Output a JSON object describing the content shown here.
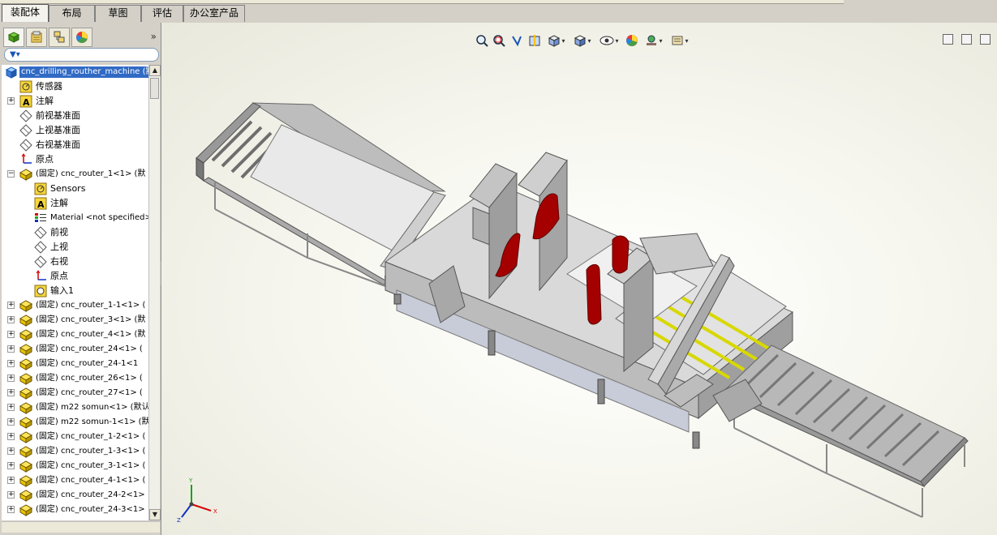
{
  "command_manager": {
    "tabs": [
      {
        "label": "装配体",
        "active": true
      },
      {
        "label": "布局",
        "active": false
      },
      {
        "label": "草图",
        "active": false
      },
      {
        "label": "评估",
        "active": false
      },
      {
        "label": "办公室产品",
        "active": false
      }
    ]
  },
  "feature_manager": {
    "panel_tabs": [
      "feature-tree",
      "property-manager",
      "configuration-manager",
      "display-manager"
    ],
    "tree": [
      {
        "label": "cnc_drilling_routher_machine (默",
        "icon": "assembly-icon",
        "expandable": false,
        "selected": true
      },
      {
        "label": "传感器",
        "icon": "sensor-icon",
        "expandable": false
      },
      {
        "label": "注解",
        "icon": "annotation-icon",
        "expandable": true,
        "symbol": "+"
      },
      {
        "label": "前视基准面",
        "icon": "plane-icon",
        "expandable": false
      },
      {
        "label": "上视基准面",
        "icon": "plane-icon",
        "expandable": false
      },
      {
        "label": "右视基准面",
        "icon": "plane-icon",
        "expandable": false
      },
      {
        "label": "原点",
        "icon": "origin-icon",
        "expandable": false
      },
      {
        "label": "(固定) cnc_router_1<1> (默",
        "icon": "part-icon",
        "expandable": true,
        "symbol": "−"
      },
      {
        "label": "Sensors",
        "icon": "sensor-icon",
        "expandable": false,
        "indent": 1
      },
      {
        "label": "注解",
        "icon": "annotation-icon",
        "expandable": false,
        "indent": 1
      },
      {
        "label": "Material <not specified>",
        "icon": "material-icon",
        "expandable": false,
        "indent": 1
      },
      {
        "label": "前视",
        "icon": "plane-icon",
        "expandable": false,
        "indent": 1
      },
      {
        "label": "上视",
        "icon": "plane-icon",
        "expandable": false,
        "indent": 1
      },
      {
        "label": "右视",
        "icon": "plane-icon",
        "expandable": false,
        "indent": 1
      },
      {
        "label": "原点",
        "icon": "origin-icon",
        "expandable": false,
        "indent": 1
      },
      {
        "label": "输入1",
        "icon": "import-icon",
        "expandable": false,
        "indent": 1
      },
      {
        "label": "(固定) cnc_router_1-1<1> (",
        "icon": "part-icon",
        "expandable": true,
        "symbol": "+"
      },
      {
        "label": "(固定) cnc_router_3<1> (默",
        "icon": "part-icon",
        "expandable": true,
        "symbol": "+"
      },
      {
        "label": "(固定) cnc_router_4<1> (默",
        "icon": "part-icon",
        "expandable": true,
        "symbol": "+"
      },
      {
        "label": "(固定) cnc_router_24<1> (",
        "icon": "part-icon",
        "expandable": true,
        "symbol": "+"
      },
      {
        "label": "(固定) cnc_router_24-1<1",
        "icon": "part-icon",
        "expandable": true,
        "symbol": "+"
      },
      {
        "label": "(固定) cnc_router_26<1> (",
        "icon": "part-icon",
        "expandable": true,
        "symbol": "+"
      },
      {
        "label": "(固定) cnc_router_27<1> (",
        "icon": "part-icon",
        "expandable": true,
        "symbol": "+"
      },
      {
        "label": "(固定) m22 somun<1> (默认",
        "icon": "part-icon",
        "expandable": true,
        "symbol": "+"
      },
      {
        "label": "(固定) m22 somun-1<1> (默",
        "icon": "part-icon",
        "expandable": true,
        "symbol": "+"
      },
      {
        "label": "(固定) cnc_router_1-2<1> (",
        "icon": "part-icon",
        "expandable": true,
        "symbol": "+"
      },
      {
        "label": "(固定) cnc_router_1-3<1> (",
        "icon": "part-icon",
        "expandable": true,
        "symbol": "+"
      },
      {
        "label": "(固定) cnc_router_3-1<1> (",
        "icon": "part-icon",
        "expandable": true,
        "symbol": "+"
      },
      {
        "label": "(固定) cnc_router_4-1<1> (",
        "icon": "part-icon",
        "expandable": true,
        "symbol": "+"
      },
      {
        "label": "(固定) cnc_router_24-2<1>",
        "icon": "part-icon",
        "expandable": true,
        "symbol": "+"
      },
      {
        "label": "(固定) cnc_router_24-3<1>",
        "icon": "part-icon",
        "expandable": true,
        "symbol": "+"
      }
    ]
  },
  "heads_up_toolbar": [
    "zoom-to-fit-icon",
    "zoom-to-area-icon",
    "previous-view-icon",
    "section-view-icon",
    "view-orientation-icon",
    "display-style-icon",
    "hide-show-items-icon",
    "edit-appearance-icon",
    "apply-scene-icon",
    "view-settings-icon"
  ],
  "triad": {
    "x": "X",
    "y": "Y",
    "z": "Z"
  },
  "colors": {
    "selection": "#316ac5",
    "part_icon": "#e8c400",
    "red_parts": "#a40000",
    "yellow_rails": "#d8d800"
  }
}
